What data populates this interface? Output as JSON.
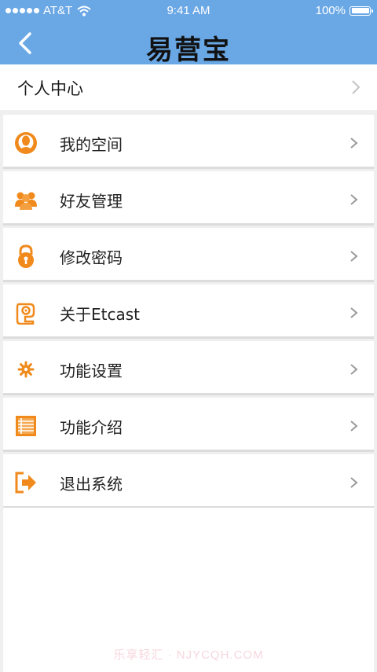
{
  "status_bar": {
    "carrier": "AT&T",
    "time": "9:41 AM",
    "battery": "100%",
    "icons": [
      "signal-dots-icon",
      "wifi-icon",
      "battery-icon"
    ]
  },
  "nav": {
    "back_icon": "back-chevron-icon",
    "title": "易营宝"
  },
  "personal_center": {
    "label": "个人中心"
  },
  "menu": [
    {
      "label": "我的空间",
      "icon": "user-icon"
    },
    {
      "label": "好友管理",
      "icon": "friends-icon"
    },
    {
      "label": "修改密码",
      "icon": "lock-icon"
    },
    {
      "label": "关于Etcast",
      "icon": "about-icon"
    },
    {
      "label": "功能设置",
      "icon": "gear-icon"
    },
    {
      "label": "功能介绍",
      "icon": "document-icon"
    },
    {
      "label": "退出系统",
      "icon": "exit-icon"
    }
  ],
  "watermark": "乐享轻汇 · NJYCQH.COM",
  "colors": {
    "nav_blue": "#6aa7e5",
    "icon_orange": "#f08a1c",
    "chevron_gray": "#9a9a9a"
  }
}
